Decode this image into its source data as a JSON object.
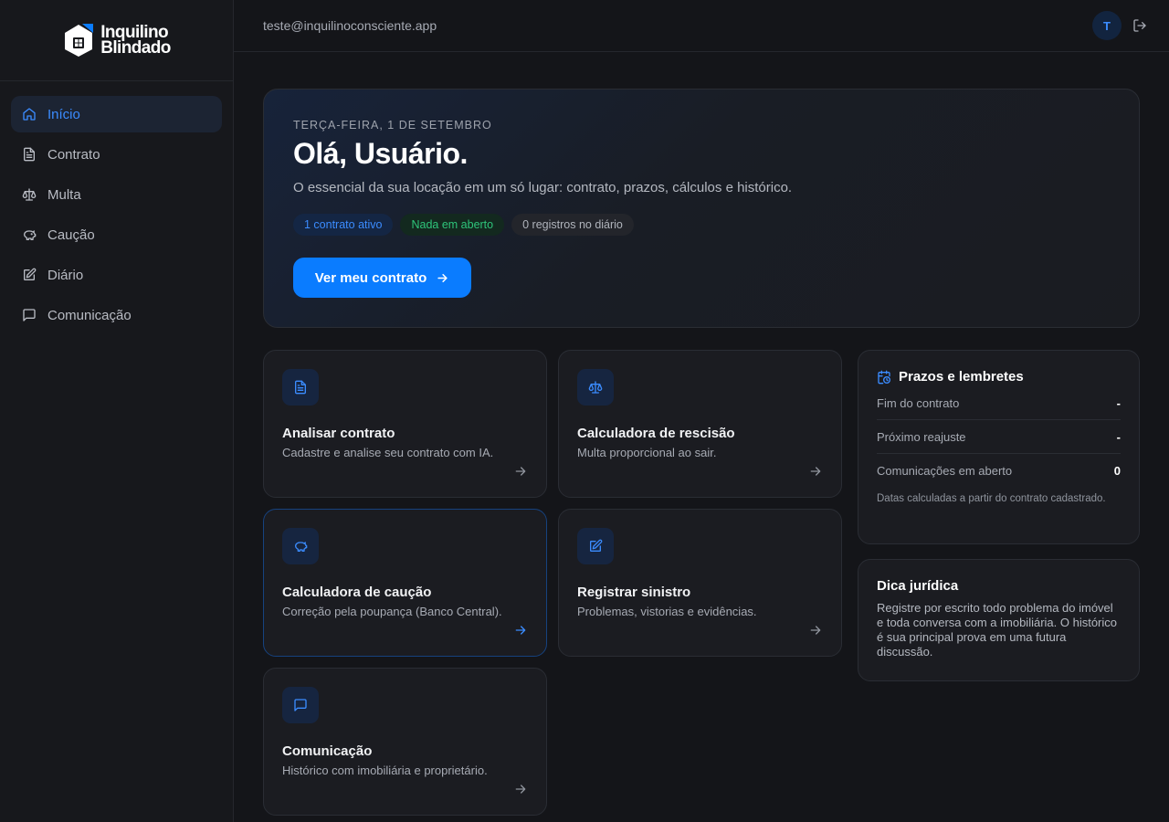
{
  "brand": {
    "line1": "Inquilino",
    "line2": "Blindado"
  },
  "user": {
    "email": "teste@inquilinoconsciente.app",
    "avatar_initial": "T"
  },
  "sidebar": {
    "items": [
      {
        "label": "Início",
        "icon": "home-icon",
        "active": true
      },
      {
        "label": "Contrato",
        "icon": "document-icon"
      },
      {
        "label": "Multa",
        "icon": "scale-icon"
      },
      {
        "label": "Caução",
        "icon": "piggy-bank-icon"
      },
      {
        "label": "Diário",
        "icon": "edit-note-icon"
      },
      {
        "label": "Comunicação",
        "icon": "chat-icon"
      }
    ]
  },
  "hero": {
    "date": "TERÇA-FEIRA, 1 DE SETEMBRO",
    "greeting": "Olá, Usuário.",
    "subtitle": "O essencial da sua locação em um só lugar: contrato, prazos, cálculos e histórico.",
    "chips": [
      "1 contrato ativo",
      "Nada em aberto",
      "0 registros no diário"
    ],
    "cta": "Ver meu contrato"
  },
  "cards": [
    {
      "title": "Analisar contrato",
      "desc": "Cadastre e analise seu contrato com IA.",
      "icon": "document-icon"
    },
    {
      "title": "Calculadora de rescisão",
      "desc": "Multa proporcional ao sair.",
      "icon": "scale-icon"
    },
    {
      "title": "Calculadora de caução",
      "desc": "Correção pela poupança (Banco Central).",
      "icon": "piggy-bank-icon"
    },
    {
      "title": "Registrar sinistro",
      "desc": "Problemas, vistorias e evidências.",
      "icon": "edit-note-icon"
    },
    {
      "title": "Comunicação",
      "desc": "Histórico com imobiliária e proprietário.",
      "icon": "chat-icon"
    }
  ],
  "deadlines": {
    "title": "Prazos e lembretes",
    "rows": [
      {
        "label": "Fim do contrato",
        "value": "-"
      },
      {
        "label": "Próximo reajuste",
        "value": "-"
      },
      {
        "label": "Comunicações em aberto",
        "value": "0"
      }
    ],
    "note": "Datas calculadas a partir do contrato cadastrado."
  },
  "tip": {
    "title": "Dica jurídica",
    "text": "Registre por escrito todo problema do imóvel e toda conversa com a imobiliária. O histórico é sua principal prova em uma futura discussão."
  },
  "colors": {
    "accent": "#0a7cff",
    "accent_text": "#3b8cff",
    "success": "#2ec47a",
    "background": "#141519"
  }
}
